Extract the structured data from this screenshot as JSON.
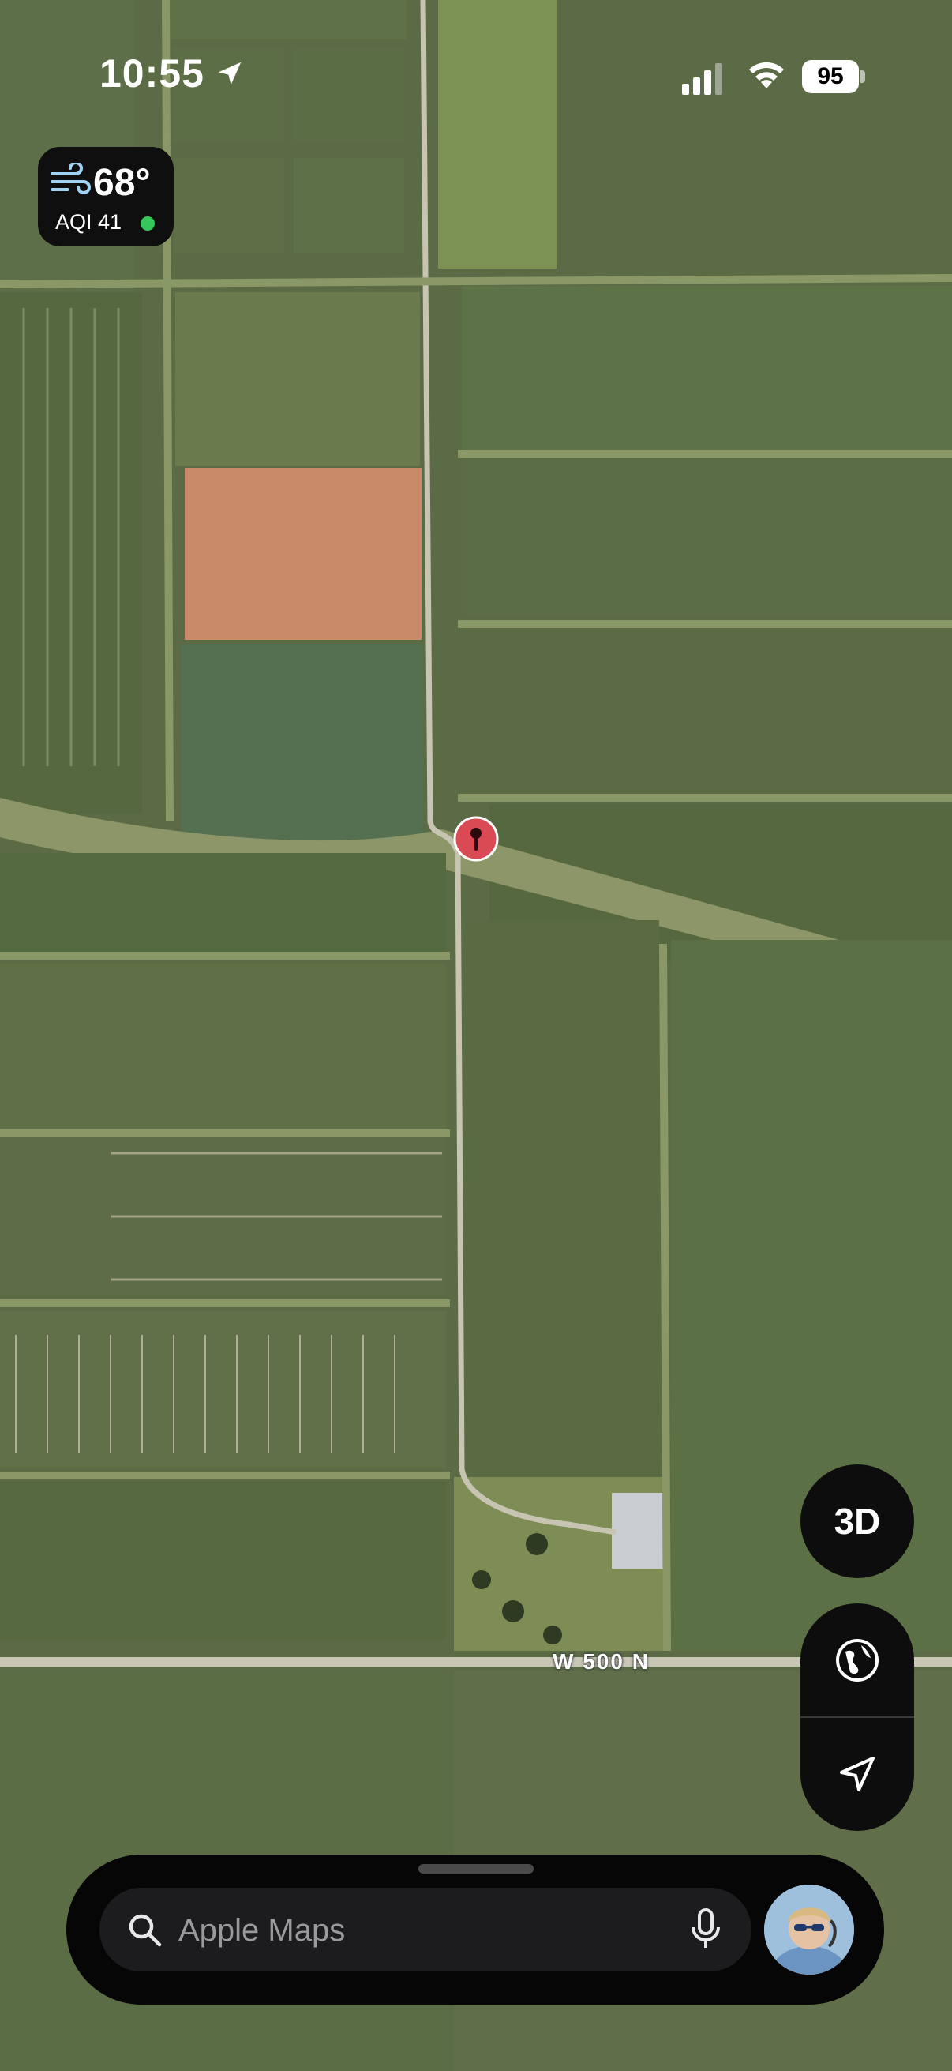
{
  "status_bar": {
    "time": "10:55",
    "battery_level": "95",
    "location_icon": "location-arrow-icon",
    "signal_icon": "cellular-signal-icon",
    "wifi_icon": "wifi-icon"
  },
  "weather": {
    "temperature": "68°",
    "aqi": "AQI 41",
    "icon": "wind-icon",
    "aqi_status_color": "#34c759"
  },
  "map": {
    "road_label": "W 500 N",
    "pin_icon": "dropped-pin-icon",
    "pin_color": "#d94a55"
  },
  "controls": {
    "view_3d_label": "3D",
    "globe_icon": "globe-icon",
    "location_icon": "navigation-arrow-icon"
  },
  "search": {
    "placeholder": "Apple Maps",
    "search_icon": "search-icon",
    "mic_icon": "microphone-icon",
    "avatar": "user-avatar"
  }
}
